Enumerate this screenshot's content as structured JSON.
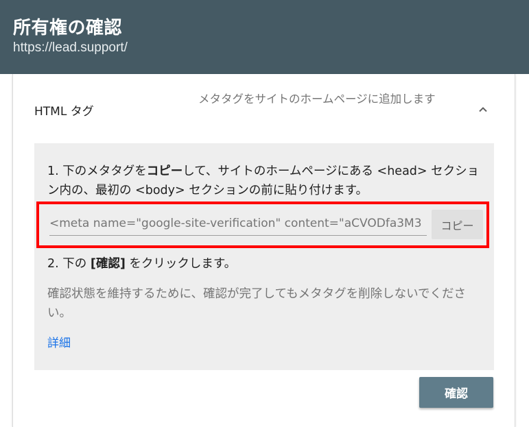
{
  "header": {
    "title": "所有権の確認",
    "url": "https://lead.support/"
  },
  "method": {
    "name": "HTML タグ",
    "description": "メタタグをサイトのホームページに追加します",
    "expanded": true
  },
  "instructions": {
    "step1_prefix": "1. 下のメタタグを",
    "step1_bold": "コピー",
    "step1_suffix": "して、サイトのホームページにある <head> セクション内の、最初の <body> セクションの前に貼り付けます。",
    "meta_tag_value": "<meta name=\"google-site-verification\" content=\"aCVODfa3M3",
    "copy_button_label": "コピー",
    "step2_prefix": "2. 下の ",
    "step2_bold": "[確認]",
    "step2_suffix": " をクリックします。",
    "note": "確認状態を維持するために、確認が完了してもメタタグを削除しないでください。",
    "details_link": "詳細"
  },
  "actions": {
    "verify_button_label": "確認"
  },
  "colors": {
    "header_bg": "#455a64",
    "panel_bg": "#eeeeee",
    "highlight_border": "#ff0000",
    "verify_button_bg": "#607d8b",
    "link_color": "#1a73e8"
  }
}
